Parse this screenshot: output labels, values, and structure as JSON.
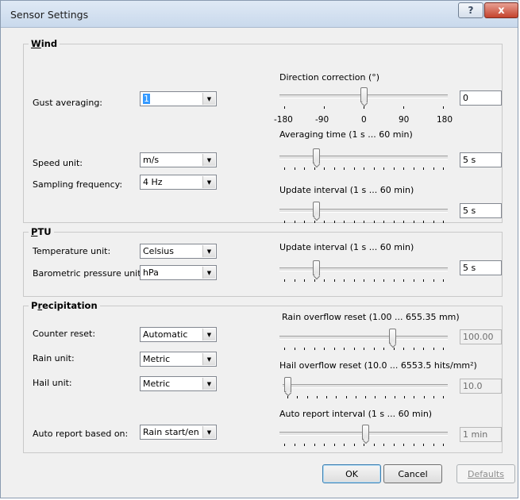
{
  "window": {
    "title": "Sensor Settings",
    "help_label": "?",
    "close_label": "x"
  },
  "wind": {
    "title_pre": "",
    "title_key": "W",
    "title_post": "ind",
    "gust_label": "Gust averaging:",
    "gust_value": "1",
    "speed_unit_label": "Speed unit:",
    "speed_unit_value": "m/s",
    "sampling_label": "Sampling frequency:",
    "sampling_value": "4 Hz",
    "direction_label": "Direction correction (°)",
    "direction_value": "0",
    "direction_position": 0.5,
    "direction_ticks": [
      "-180",
      "-90",
      "0",
      "90",
      "180"
    ],
    "averaging_label": "Averaging time (1 s ... 60 min)",
    "averaging_value": "5 s",
    "averaging_position": 0.2,
    "update_label": "Update interval (1 s ... 60 min)",
    "update_value": "5 s",
    "update_position": 0.2
  },
  "ptu": {
    "title_pre": "",
    "title_key": "P",
    "title_post": "TU",
    "temp_label": "Temperature unit:",
    "temp_value": "Celsius",
    "pressure_label": "Barometric pressure unit:",
    "pressure_value": "hPa",
    "update_label": "Update interval (1 s ... 60 min)",
    "update_value": "5 s",
    "update_position": 0.2
  },
  "precipitation": {
    "title_pre": "P",
    "title_key": "r",
    "title_post": "ecipitation",
    "counter_label": "Counter reset:",
    "counter_value": "Automatic",
    "rain_unit_label": "Rain unit:",
    "rain_unit_value": "Metric",
    "hail_unit_label": "Hail unit:",
    "hail_unit_value": "Metric",
    "auto_report_label": "Auto report based on:",
    "auto_report_value": "Rain start/enc",
    "rain_overflow_label": "Rain overflow reset (1.00 ... 655.35 mm)",
    "rain_overflow_value": "100.00",
    "rain_overflow_position": 0.68,
    "hail_overflow_label": "Hail overflow reset (10.0 ... 6553.5 hits/mm²)",
    "hail_overflow_value": "10.0",
    "hail_overflow_position": 0.0,
    "auto_interval_label": "Auto report interval (1 s ... 60 min)",
    "auto_interval_value": "1 min",
    "auto_interval_position": 0.51
  },
  "buttons": {
    "ok": "OK",
    "cancel": "Cancel",
    "defaults": "Defaults"
  },
  "colors": {
    "selection": "#3399ff",
    "dialog_background": "#f0f0f0",
    "close_button": "#c4432d"
  }
}
